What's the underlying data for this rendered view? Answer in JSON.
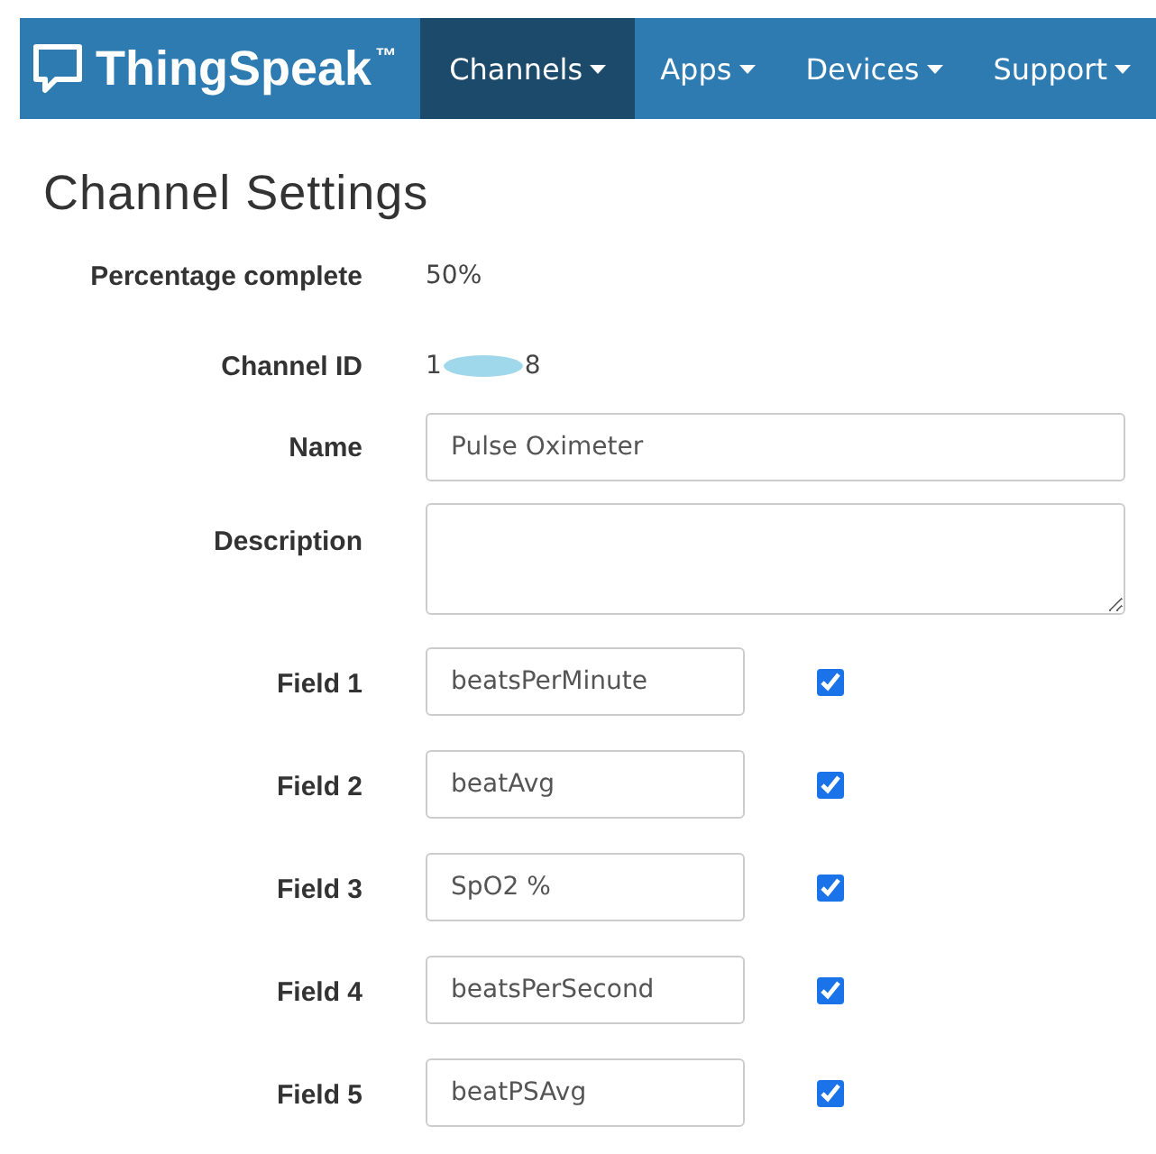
{
  "navbar": {
    "brand": "ThingSpeak",
    "trademark": "™",
    "items": [
      {
        "label": "Channels",
        "selected": true
      },
      {
        "label": "Apps",
        "selected": false
      },
      {
        "label": "Devices",
        "selected": false
      },
      {
        "label": "Support",
        "selected": false
      }
    ]
  },
  "page_title": "Channel Settings",
  "percentage_complete": {
    "label": "Percentage complete",
    "value": "50%"
  },
  "channel_id": {
    "label": "Channel ID",
    "value_start": "1",
    "value_end": "8"
  },
  "name": {
    "label": "Name",
    "value": "Pulse Oximeter"
  },
  "description": {
    "label": "Description"
  },
  "fields": [
    {
      "label": "Field 1",
      "value": "beatsPerMinute",
      "checked": true
    },
    {
      "label": "Field 2",
      "value": "beatAvg",
      "checked": true
    },
    {
      "label": "Field 3",
      "value": "SpO2 %",
      "checked": true
    },
    {
      "label": "Field 4",
      "value": "beatsPerSecond",
      "checked": true
    },
    {
      "label": "Field 5",
      "value": "beatPSAvg",
      "checked": true
    }
  ]
}
